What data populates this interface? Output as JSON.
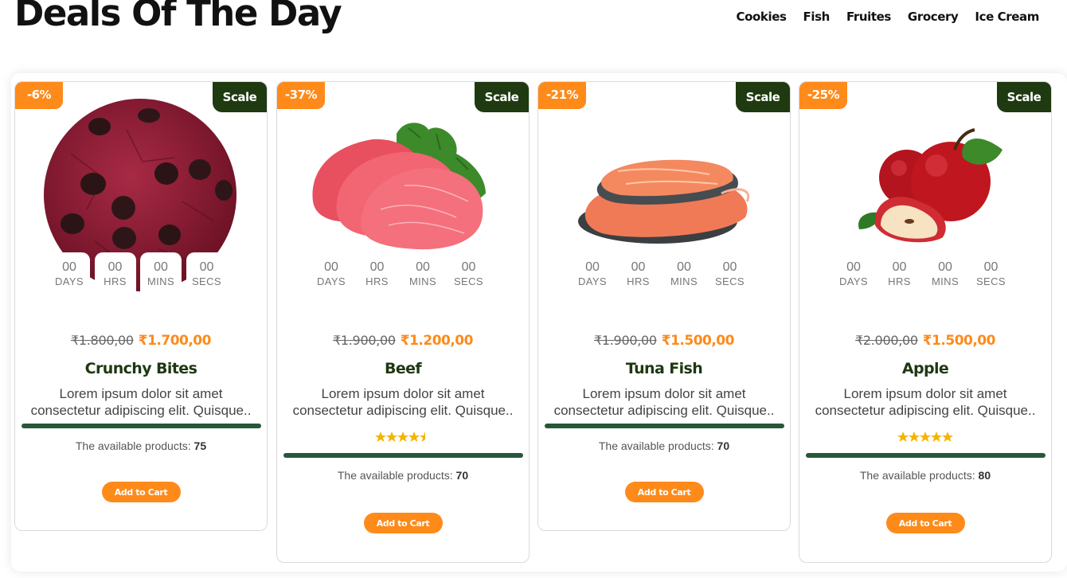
{
  "heading": {
    "title": "Deals Of The Day"
  },
  "categories": [
    "Cookies",
    "Fish",
    "Fruites",
    "Grocery",
    "Ice Cream"
  ],
  "products": [
    {
      "discount": "-6%",
      "badge": "Scale",
      "countdown": {
        "days": "00",
        "hrs": "00",
        "mins": "00",
        "secs": "00",
        "days_label": "DAYS",
        "hrs_label": "HRS",
        "mins_label": "MINS",
        "secs_label": "SECS"
      },
      "old_price": "₹1.800,00",
      "new_price": "₹1.700,00",
      "name": "Crunchy Bites",
      "desc_line1": "Lorem ipsum dolor sit amet",
      "desc_line2": "consectetur adipiscing elit. Quisque..",
      "rating": null,
      "available_label": "The available products:",
      "available": "75",
      "cta": "Add to Cart"
    },
    {
      "discount": "-37%",
      "badge": "Scale",
      "countdown": {
        "days": "00",
        "hrs": "00",
        "mins": "00",
        "secs": "00",
        "days_label": "DAYS",
        "hrs_label": "HRS",
        "mins_label": "MINS",
        "secs_label": "SECS"
      },
      "old_price": "₹1.900,00",
      "new_price": "₹1.200,00",
      "name": "Beef",
      "desc_line1": "Lorem ipsum dolor sit amet",
      "desc_line2": "consectetur adipiscing elit. Quisque..",
      "rating": 4.5,
      "available_label": "The available products:",
      "available": "70",
      "cta": "Add to Cart"
    },
    {
      "discount": "-21%",
      "badge": "Scale",
      "countdown": {
        "days": "00",
        "hrs": "00",
        "mins": "00",
        "secs": "00",
        "days_label": "DAYS",
        "hrs_label": "HRS",
        "mins_label": "MINS",
        "secs_label": "SECS"
      },
      "old_price": "₹1.900,00",
      "new_price": "₹1.500,00",
      "name": "Tuna Fish",
      "desc_line1": "Lorem ipsum dolor sit amet",
      "desc_line2": "consectetur adipiscing elit. Quisque..",
      "rating": null,
      "available_label": "The available products:",
      "available": "70",
      "cta": "Add to Cart"
    },
    {
      "discount": "-25%",
      "badge": "Scale",
      "countdown": {
        "days": "00",
        "hrs": "00",
        "mins": "00",
        "secs": "00",
        "days_label": "DAYS",
        "hrs_label": "HRS",
        "mins_label": "MINS",
        "secs_label": "SECS"
      },
      "old_price": "₹2.000,00",
      "new_price": "₹1.500,00",
      "name": "Apple",
      "desc_line1": "Lorem ipsum dolor sit amet",
      "desc_line2": "consectetur adipiscing elit. Quisque..",
      "rating": 5,
      "available_label": "The available products:",
      "available": "80",
      "cta": "Add to Cart"
    }
  ],
  "colors": {
    "accent": "#fe8a1a",
    "badge_dark": "#1f3a10",
    "bar": "#27573a",
    "star": "#f5b400"
  }
}
